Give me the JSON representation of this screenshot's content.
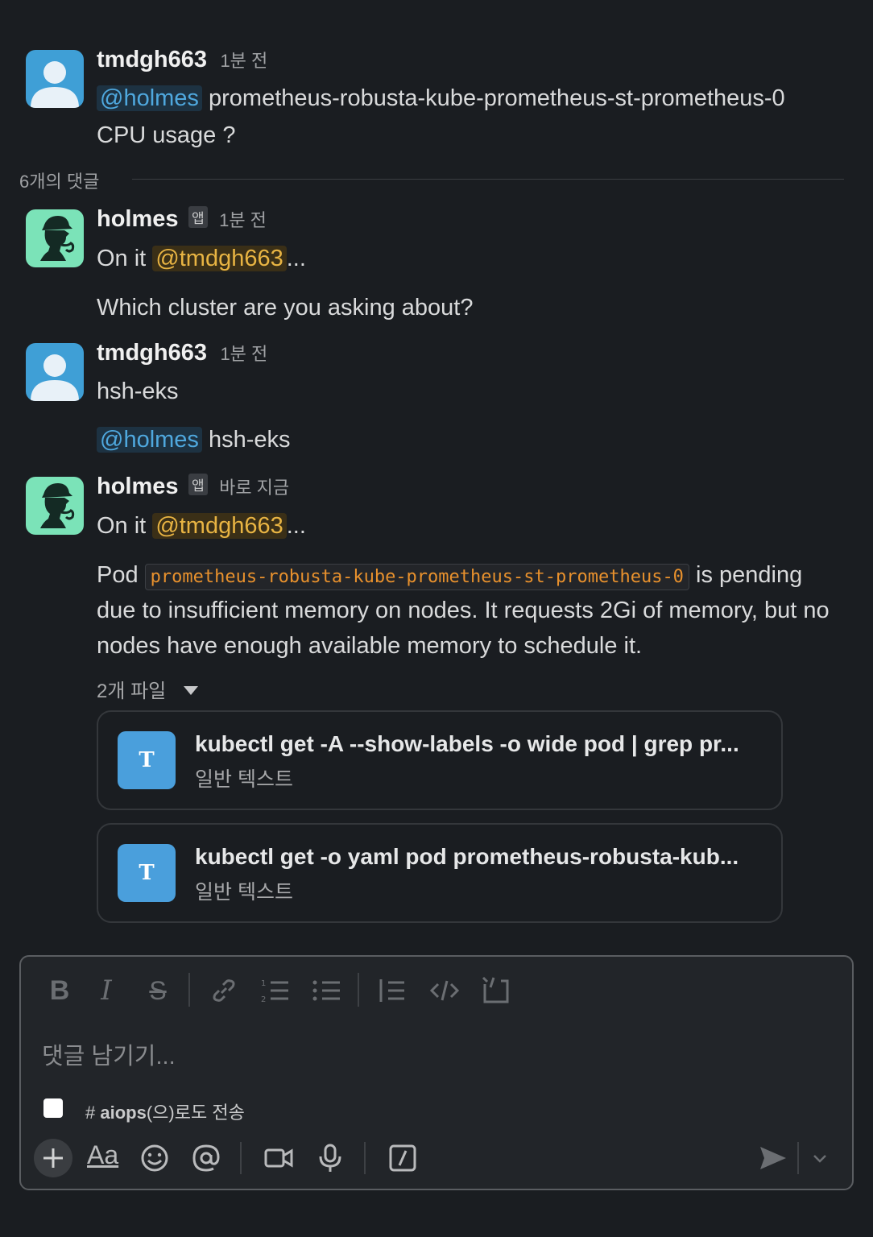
{
  "messages": [
    {
      "author": "tmdgh663",
      "time": "1분 전",
      "mention": "@holmes",
      "text_line1": "prometheus-robusta-kube-prometheus-st-prometheus-0",
      "text_line2": "CPU usage ?"
    }
  ],
  "thread": {
    "reply_count": "6개의 댓글"
  },
  "replies": [
    {
      "author": "holmes",
      "badge": "앱",
      "time": "1분 전",
      "prefix": "On it",
      "mention": "@tmdgh663",
      "suffix": "...",
      "followup": "Which cluster are you asking about?"
    },
    {
      "author": "tmdgh663",
      "time": "1분 전",
      "text": "hsh-eks",
      "mention": "@holmes",
      "mention_text": "hsh-eks"
    },
    {
      "author": "holmes",
      "badge": "앱",
      "time": "바로 지금",
      "prefix": "On it",
      "mention": "@tmdgh663",
      "suffix": "...",
      "pod_word": "Pod",
      "pod_code": "prometheus-robusta-kube-prometheus-st-prometheus-0",
      "line1_tail": "is pending",
      "line2": "due to insufficient memory on nodes. It requests 2Gi of memory, but no",
      "line3": "nodes have enough available memory to schedule it.",
      "files_label": "2개 파일",
      "files": [
        {
          "icon": "T",
          "title": "kubectl get -A --show-labels -o wide pod | grep pr...",
          "type": "일반 텍스트"
        },
        {
          "icon": "T",
          "title": "kubectl get -o yaml pod prometheus-robusta-kub...",
          "type": "일반 텍스트"
        }
      ]
    }
  ],
  "composer": {
    "placeholder": "댓글 남기기...",
    "also_send_prefix": "#",
    "also_send_channel": "aiops",
    "also_send_suffix": "(으)로도 전송",
    "format_label": "Aa"
  },
  "colors": {
    "background": "#1a1d21",
    "mention_blue": "#4fa8de",
    "mention_gold": "#e8b443",
    "code_orange": "#e8912d",
    "file_icon": "#4a9fdc",
    "bot_avatar": "#7be3b8",
    "user_avatar": "#3f9fd6"
  },
  "icons": [
    "bold-icon",
    "italic-icon",
    "strikethrough-icon",
    "link-icon",
    "ordered-list-icon",
    "bullet-list-icon",
    "blockquote-icon",
    "code-icon",
    "code-block-icon",
    "plus-icon",
    "emoji-icon",
    "mention-icon",
    "video-icon",
    "microphone-icon",
    "slash-command-icon",
    "send-icon",
    "chevron-down-icon"
  ]
}
